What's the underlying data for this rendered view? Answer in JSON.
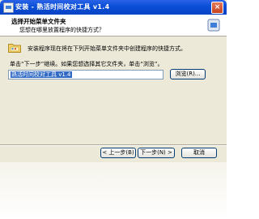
{
  "window": {
    "title": "安装 - 熟活时间校对工具 v1.4",
    "close_glyph": "×"
  },
  "header": {
    "title": "选择开始菜单文件夹",
    "subtitle": "您想在哪里放置程序的快捷方式？"
  },
  "body": {
    "info": "安装程序现在将在下列开始菜单文件夹中创建程序的快捷方式。",
    "instruction": "单击“下一步”继续。如果您想选择其它文件夹，单击“浏览”。",
    "folder_value": "熟活时间校对工具 v1.4",
    "browse_label": "浏览(R)..."
  },
  "footer": {
    "back_label": "< 上一步(B)",
    "next_label": "下一步(N) >",
    "cancel_label": "取消"
  },
  "colors": {
    "titlebar": "#0a4ed6",
    "dialog_bg": "#ece9d8",
    "selection": "#316ac5"
  },
  "icons": [
    "app-icon",
    "close-icon",
    "wizard-header-icon",
    "start-menu-folder-icon"
  ]
}
